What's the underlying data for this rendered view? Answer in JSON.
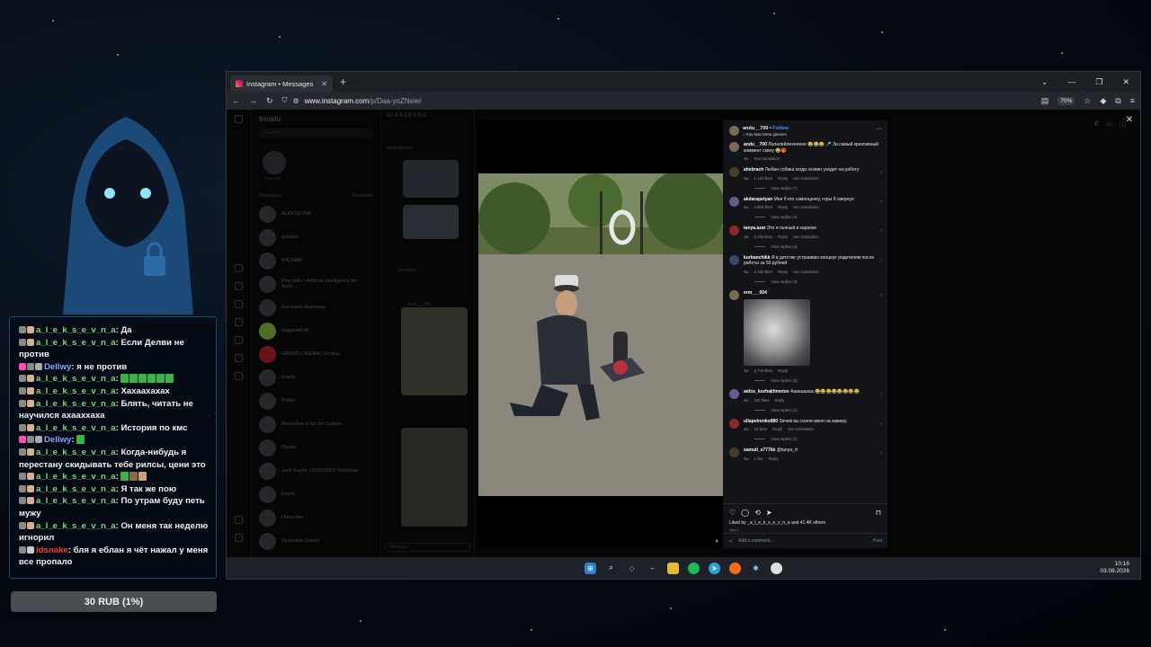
{
  "chat": {
    "messages": [
      {
        "user": "a_l_e_k_s_e_v_n_a",
        "user_color": "green",
        "text": "Да",
        "emotes": 0
      },
      {
        "user": "a_l_e_k_s_e_v_n_a",
        "user_color": "green",
        "text": "Если Делви не против",
        "emotes": 0
      },
      {
        "user": "Dellwy",
        "user_color": "blue",
        "text": "я не против",
        "emotes": 0
      },
      {
        "user": "a_l_e_k_s_e_v_n_a",
        "user_color": "green",
        "text": "",
        "emotes": 6
      },
      {
        "user": "a_l_e_k_s_e_v_n_a",
        "user_color": "green",
        "text": "Хахаахахах",
        "emotes": 0
      },
      {
        "user": "a_l_e_k_s_e_v_n_a",
        "user_color": "green",
        "text": "Блять, читать не научился ахааххаха",
        "emotes": 0
      },
      {
        "user": "a_l_e_k_s_e_v_n_a",
        "user_color": "green",
        "text": "История по кмс",
        "emotes": 0
      },
      {
        "user": "Dellwy",
        "user_color": "blue",
        "text": "",
        "emotes": 1
      },
      {
        "user": "a_l_e_k_s_e_v_n_a",
        "user_color": "green",
        "text": "Когда-нибудь я перестану скидывать тебе рилсы, цени это",
        "emotes": 0
      },
      {
        "user": "a_l_e_k_s_e_v_n_a",
        "user_color": "green",
        "text": "",
        "emotes": 3
      },
      {
        "user": "a_l_e_k_s_e_v_n_a",
        "user_color": "green",
        "text": "Я так же пою",
        "emotes": 0
      },
      {
        "user": "a_l_e_k_s_e_v_n_a",
        "user_color": "green",
        "text": "По утрам буду петь мужу",
        "emotes": 0
      },
      {
        "user": "a_l_e_k_s_e_v_n_a",
        "user_color": "green",
        "text": "Он меня так неделю игнорил",
        "emotes": 0
      },
      {
        "user": "idsnake",
        "user_color": "red",
        "text": "бля я еблан я чёт нажал у меня все пропало",
        "emotes": 0
      }
    ]
  },
  "donation": {
    "label": "30 RUB (1%)"
  },
  "browser": {
    "tab_title": "Instagram • Messages",
    "url_host": "www.instagram.com",
    "url_path": "/p/Daa-yoZNeie/",
    "zoom": "70%"
  },
  "ig_background": {
    "account": "trowfu",
    "search_placeholder": "Search",
    "note_label": "Your note",
    "messages_label": "Messages",
    "requests_label": "Requests",
    "conversations": [
      {
        "name": "ALEKSEVNA",
        "sub": ""
      },
      {
        "name": "goldiest",
        "sub": ""
      },
      {
        "name": "RALINAP",
        "sub": ""
      },
      {
        "name": "Pine Hills • Artificial Intelligence for Archi…",
        "sub": ""
      },
      {
        "name": "Бистерия Быкошак",
        "sub": ""
      },
      {
        "name": "Higgsfield AI",
        "sub": ""
      },
      {
        "name": "GRAND CINEMA | Алтачь",
        "sub": ""
      },
      {
        "name": "trowfu",
        "sub": ""
      },
      {
        "name": "Rololo",
        "sub": ""
      },
      {
        "name": "Melon/line is for the Culture",
        "sub": ""
      },
      {
        "name": "Rucsin",
        "sub": ""
      },
      {
        "name": "Jorin Kaylor | FOCUSED Sketchup",
        "sub": ""
      },
      {
        "name": "trowfu",
        "sub": ""
      },
      {
        "name": "Omercher",
        "sub": ""
      },
      {
        "name": "Sebastian Drauer",
        "sub": ""
      }
    ],
    "chat_header": "ALEKSEVNA",
    "chat_items": [
      "aleshabicrex",
      "Soroptica",
      "andu__700"
    ],
    "message_placeholder": "Message..."
  },
  "post": {
    "author": "andu__700",
    "follow_label": "Follow",
    "song": "Ray-Ban Meta glasses",
    "caption_user": "andu__700",
    "caption": "Лалалейлеееееее 😂😂😂 🎤 За самый креативный коммент скину 😂🎁",
    "caption_meta": [
      "4w",
      "See translation"
    ],
    "comments": [
      {
        "user": "ahebrach",
        "text": "Любая собака когда хозяин уходит на работу",
        "meta": [
          "3w",
          "1,122 likes",
          "Reply",
          "See translation"
        ],
        "replies": "View replies (7)"
      },
      {
        "user": "akdarapetyan",
        "text": "Мне б его самооценку, горы б свернул",
        "meta": [
          "3w",
          "2,806 likes",
          "Reply",
          "See translation"
        ],
        "replies": "View replies (4)"
      },
      {
        "user": "tanya.azar",
        "text": "Это я пьяный в караоке",
        "meta": [
          "3w",
          "5,784 likes",
          "Reply",
          "See translation"
        ],
        "replies": "View replies (4)"
      },
      {
        "user": "kurbanchikk",
        "text": "Я в детстве устраиваю концерт родителям после работы за 50 рублей",
        "meta": [
          "3w",
          "2,184 likes",
          "Reply",
          "See translation"
        ],
        "replies": "View replies (2)"
      },
      {
        "user": "erm___004",
        "text": "",
        "meta": [
          "4w",
          "2,740 likes",
          "Reply"
        ],
        "replies": "View replies (3)",
        "image": true
      },
      {
        "user": "aidos_kozhakhmetov",
        "text": "Ааааааааа 😂😂😂😂😂😂😂😂",
        "meta": [
          "3w",
          "182 likes",
          "Reply"
        ],
        "replies": "View replies (1)"
      },
      {
        "user": "ullapetrenko880",
        "text": "Зачем вы сняли меня на камеру",
        "meta": [
          "3w",
          "23 likes",
          "Reply",
          "See translation"
        ],
        "replies": "View replies (2)"
      },
      {
        "user": "samuil_s777kk",
        "text": "@tanya_rt",
        "meta": [
          "3w",
          "1 like",
          "Reply"
        ],
        "replies": ""
      }
    ],
    "liked_by": "Liked by _a_l_e_k_s_e_v_n_a and 41.4K others",
    "date": "July 1",
    "add_comment_placeholder": "Add a comment...",
    "post_button": "Post"
  },
  "taskbar": {
    "time": "10:16",
    "date": "03.08.2026",
    "icons": [
      "windows-start",
      "search",
      "vscode",
      "terminal",
      "explorer",
      "spotify",
      "telegram",
      "firefox",
      "perplexity",
      "chrome"
    ]
  },
  "colors": {
    "accent_blue": "#4a8fff",
    "chat_green": "#7dd87d",
    "chat_red": "#ff3b3b"
  }
}
